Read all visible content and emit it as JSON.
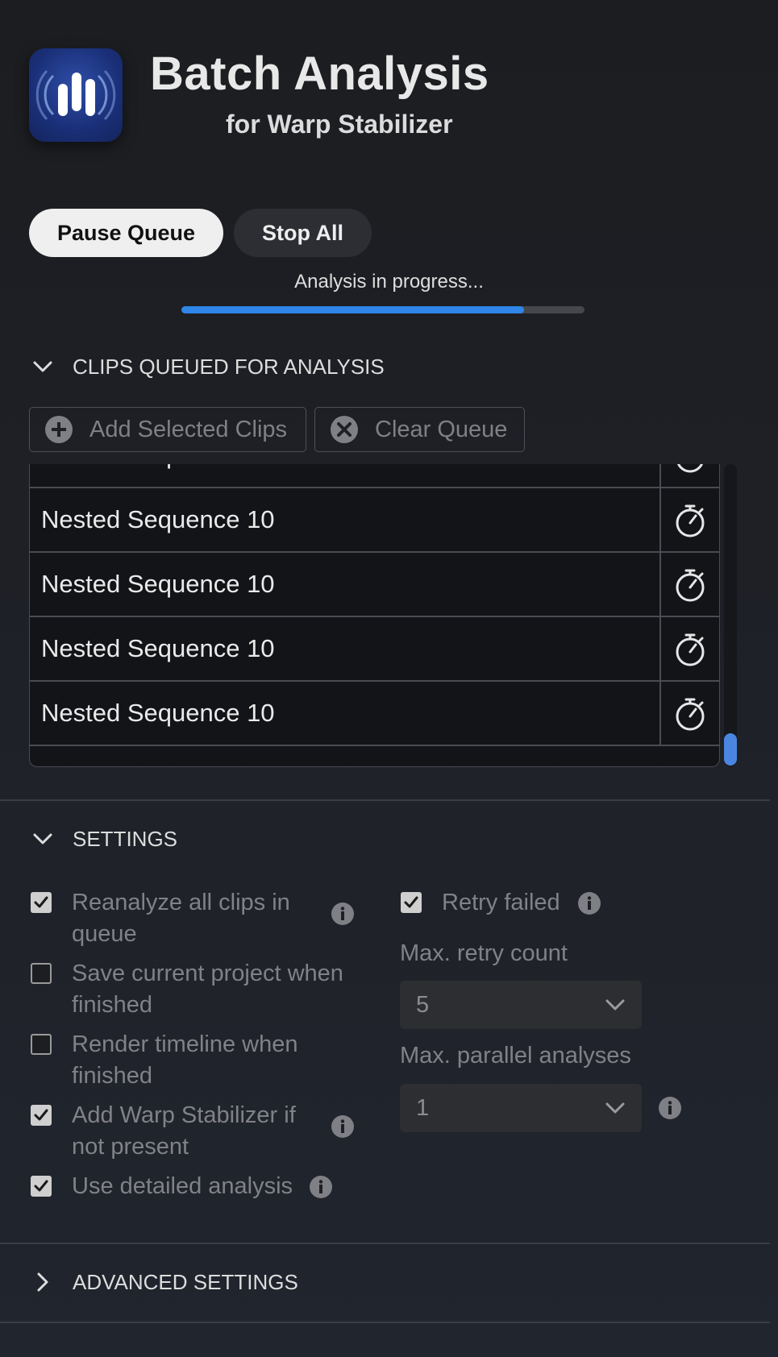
{
  "header": {
    "title": "Batch Analysis",
    "subtitle": "for Warp Stabilizer",
    "logo_icon": "waveform-bars-icon"
  },
  "controls": {
    "pause_label": "Pause Queue",
    "stop_label": "Stop All",
    "status_text": "Analysis in progress...",
    "progress_fraction": 0.85
  },
  "queue_section": {
    "title": "CLIPS QUEUED FOR ANALYSIS",
    "add_label": "Add Selected Clips",
    "clear_label": "Clear Queue",
    "items": [
      {
        "name": "Nested Sequence 10",
        "icon": "stopwatch-icon"
      },
      {
        "name": "Nested Sequence 10",
        "icon": "stopwatch-icon"
      },
      {
        "name": "Nested Sequence 10",
        "icon": "stopwatch-icon"
      },
      {
        "name": "Nested Sequence 10",
        "icon": "stopwatch-icon"
      },
      {
        "name": "Nested Sequence 10",
        "icon": "stopwatch-icon"
      }
    ]
  },
  "settings_section": {
    "title": "SETTINGS",
    "options": [
      {
        "label": "Reanalyze all clips in queue",
        "checked": true
      },
      {
        "label": "Save current project when finished",
        "checked": false
      },
      {
        "label": "Render timeline when finished",
        "checked": false
      },
      {
        "label": "Add Warp Stabilizer if not present",
        "checked": true
      },
      {
        "label": "Use detailed analysis",
        "checked": true
      }
    ],
    "retry_failed": {
      "label": "Retry failed",
      "checked": true
    },
    "max_retry": {
      "label": "Max. retry count",
      "value": "5"
    },
    "max_parallel": {
      "label": "Max. parallel analyses",
      "value": "1"
    }
  },
  "advanced_section": {
    "title": "ADVANCED SETTINGS",
    "expanded": false
  },
  "colors": {
    "accent": "#2f86e8",
    "background": "#1e2026"
  }
}
